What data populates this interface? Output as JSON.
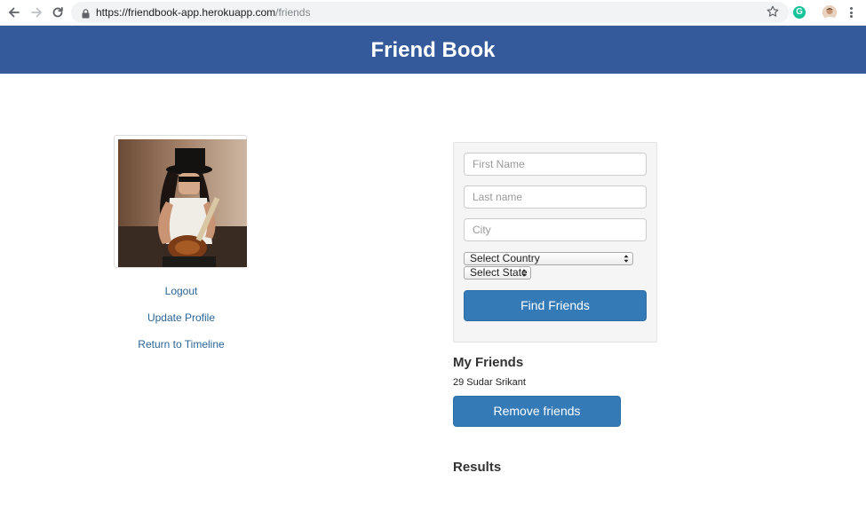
{
  "browser": {
    "url_host": "https://friendbook-app.herokuapp.com",
    "url_path": "/friends",
    "extension_letter": "G"
  },
  "header": {
    "title": "Friend Book"
  },
  "sidebar": {
    "links": [
      {
        "label": "Logout"
      },
      {
        "label": "Update Profile"
      },
      {
        "label": "Return to Timeline"
      }
    ]
  },
  "search": {
    "first_name_placeholder": "First Name",
    "last_name_placeholder": "Last name",
    "city_placeholder": "City",
    "country_selected": "Select Country",
    "state_selected": "Select State",
    "submit_label": "Find Friends"
  },
  "friends": {
    "heading": "My Friends",
    "items": [
      "29 Sudar Srikant"
    ],
    "remove_label": "Remove friends"
  },
  "results": {
    "heading": "Results"
  },
  "colors": {
    "header_bg": "#345a9c",
    "primary_button": "#337ab7",
    "link": "#2a6496"
  }
}
